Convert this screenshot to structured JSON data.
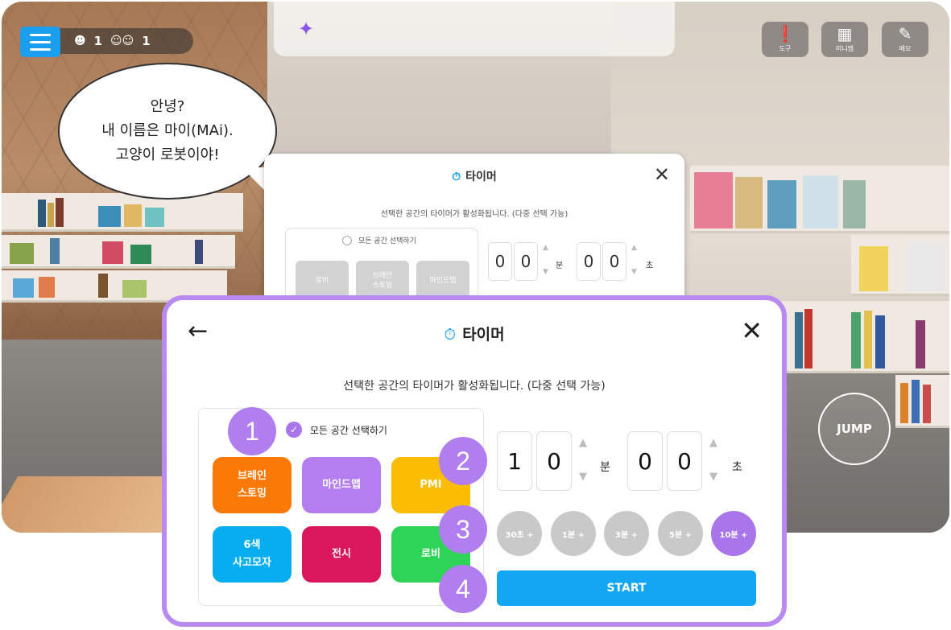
{
  "hud": {
    "user_count_1": "1",
    "user_count_2": "1",
    "tools": [
      {
        "label": "도구",
        "icon": "tool-icon"
      },
      {
        "label": "미니맵",
        "icon": "minimap-icon"
      },
      {
        "label": "메모",
        "icon": "memo-icon"
      }
    ],
    "jump_label": "JUMP"
  },
  "bubble": {
    "line1": "안녕?",
    "line2": "내 이름은 마이(MAi).",
    "line3": "고양이 로봇이야!"
  },
  "mini_dialog": {
    "title": "타이머",
    "subtitle": "선택한 공간의 타이머가 활성화됩니다. (다중 선택 가능)",
    "select_all": "모든 공간 선택하기",
    "chips": [
      "로비",
      "브레인\n스토밍",
      "마인드맵"
    ],
    "digits": [
      "0",
      "0",
      "0",
      "0"
    ],
    "unit_min": "분",
    "unit_sec": "초"
  },
  "timer": {
    "title": "타이머",
    "subtitle": "선택한 공간의 타이머가 활성화됩니다. (다중 선택 가능)",
    "select_all": "모든 공간 선택하기",
    "spaces": [
      {
        "label": "브레인\n스토밍",
        "color": "#fb7a07"
      },
      {
        "label": "마인드맵",
        "color": "#b57ef0"
      },
      {
        "label": "PMI",
        "color": "#fbbd02"
      },
      {
        "label": "6색\n사고모자",
        "color": "#06aef0"
      },
      {
        "label": "전시",
        "color": "#d8185a"
      },
      {
        "label": "로비",
        "color": "#2dd457"
      }
    ],
    "minutes": [
      "1",
      "0"
    ],
    "seconds": [
      "0",
      "0"
    ],
    "unit_min": "분",
    "unit_sec": "초",
    "presets": [
      "30초 +",
      "1분 +",
      "3분 +",
      "5분 +",
      "10분 +"
    ],
    "active_preset": "10분 +",
    "start_label": "START"
  },
  "steps": [
    "1",
    "2",
    "3",
    "4"
  ],
  "colors": {
    "accent_purple": "#b17ef0",
    "accent_blue": "#13a6f2"
  }
}
